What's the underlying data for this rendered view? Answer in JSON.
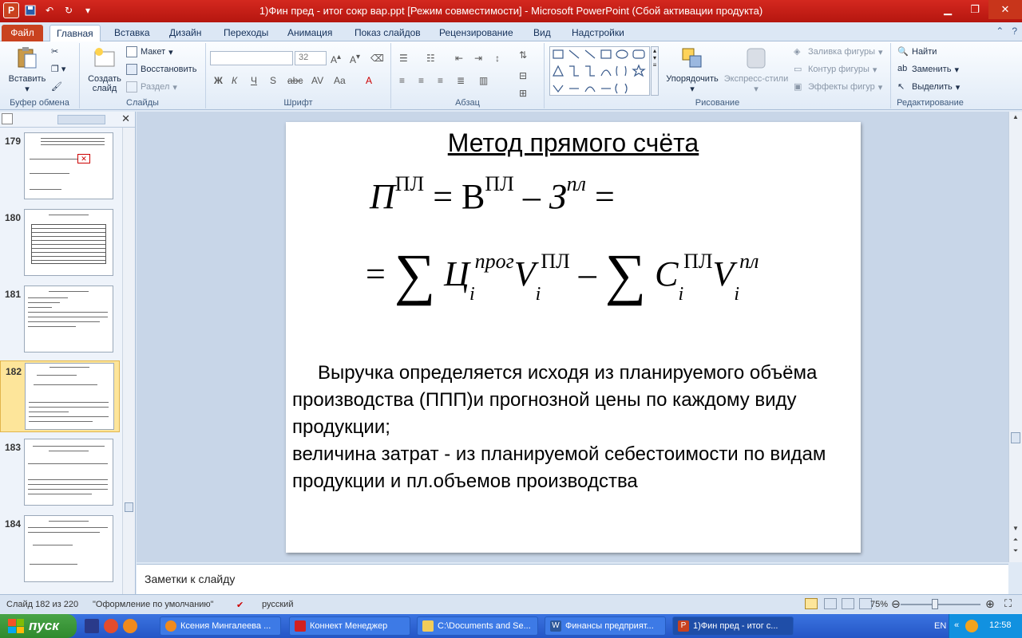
{
  "window": {
    "title": "1)Фин пред - итог сокр вар.ppt [Режим совместимости]  -  Microsoft PowerPoint (Сбой активации продукта)"
  },
  "qat": {
    "app_letter": "P",
    "undo_label": "↶",
    "redo_label": "↻"
  },
  "tabs": [
    "Файл",
    "Главная",
    "Вставка",
    "Дизайн",
    "Переходы",
    "Анимация",
    "Показ слайдов",
    "Рецензирование",
    "Вид",
    "Надстройки"
  ],
  "ribbon": {
    "clipboard": {
      "paste": "Вставить",
      "group": "Буфер обмена"
    },
    "slides": {
      "new_slide_line1": "Создать",
      "new_slide_line2": "слайд",
      "layout": "Макет",
      "reset": "Восстановить",
      "section": "Раздел",
      "group": "Слайды"
    },
    "font": {
      "font_name": "",
      "font_size": "32",
      "group": "Шрифт"
    },
    "paragraph": {
      "group": "Абзац"
    },
    "drawing": {
      "arrange": "Упорядочить",
      "quick_styles": "Экспресс-стили",
      "shape_fill": "Заливка фигуры",
      "shape_outline": "Контур фигуры",
      "shape_effects": "Эффекты фигур",
      "group": "Рисование"
    },
    "editing": {
      "find": "Найти",
      "replace": "Заменить",
      "select": "Выделить",
      "group": "Редактирование"
    }
  },
  "thumbnails": [
    {
      "number": "179",
      "selected": false
    },
    {
      "number": "180",
      "selected": false
    },
    {
      "number": "181",
      "selected": false
    },
    {
      "number": "182",
      "selected": true
    },
    {
      "number": "183",
      "selected": false
    },
    {
      "number": "184",
      "selected": false
    }
  ],
  "slide": {
    "title": "Метод прямого счёта",
    "formula_line1": {
      "p": "П",
      "p_sup": "ПЛ",
      "eq1": "=",
      "v": "В",
      "v_sup": "ПЛ",
      "minus": "–",
      "z": "З",
      "z_sup": "пл",
      "eq2": "="
    },
    "formula_line2": {
      "eq": "=",
      "sum": "∑",
      "c": "Ц",
      "c_sup": "прог",
      "c_sub": "i",
      "vol": "V",
      "vol_sup": "ПЛ",
      "vol_sub": "i",
      "minus": "–",
      "sum2": "∑",
      "cost": "C",
      "cost_sub": "i",
      "cost_sup": "ПЛ",
      "vol2": "V",
      "vol2_sup": "пл",
      "vol2_sub": "i"
    },
    "body_p1": "Выручка определяется исходя из планируемого объёма производства (ППП)и прогнозной цены по каждому виду продукции;",
    "body_p2": "величина затрат - из планируемой себестоимости по видам продукции и пл.объемов производства"
  },
  "notes": {
    "placeholder": "Заметки к слайду"
  },
  "statusbar": {
    "slide_info": "Слайд 182 из 220",
    "theme": "\"Оформление по умолчанию\"",
    "language": "русский",
    "zoom": "75%",
    "zoom_level": 0.4
  },
  "taskbar": {
    "start": "пуск",
    "tasks": [
      "Ксения Мингалеева ...",
      "Коннект Менеджер",
      "C:\\Documents and Se...",
      "Финансы предприят...",
      "1)Фин пред - итог с..."
    ],
    "lang": "EN",
    "clock": "12:58"
  },
  "colors": {
    "title_bar": "#c8281f",
    "file_tab": "#c9421f",
    "selected_thumb": "#fde59a",
    "taskbar": "#2a5fd0",
    "start": "#3a9a38"
  }
}
